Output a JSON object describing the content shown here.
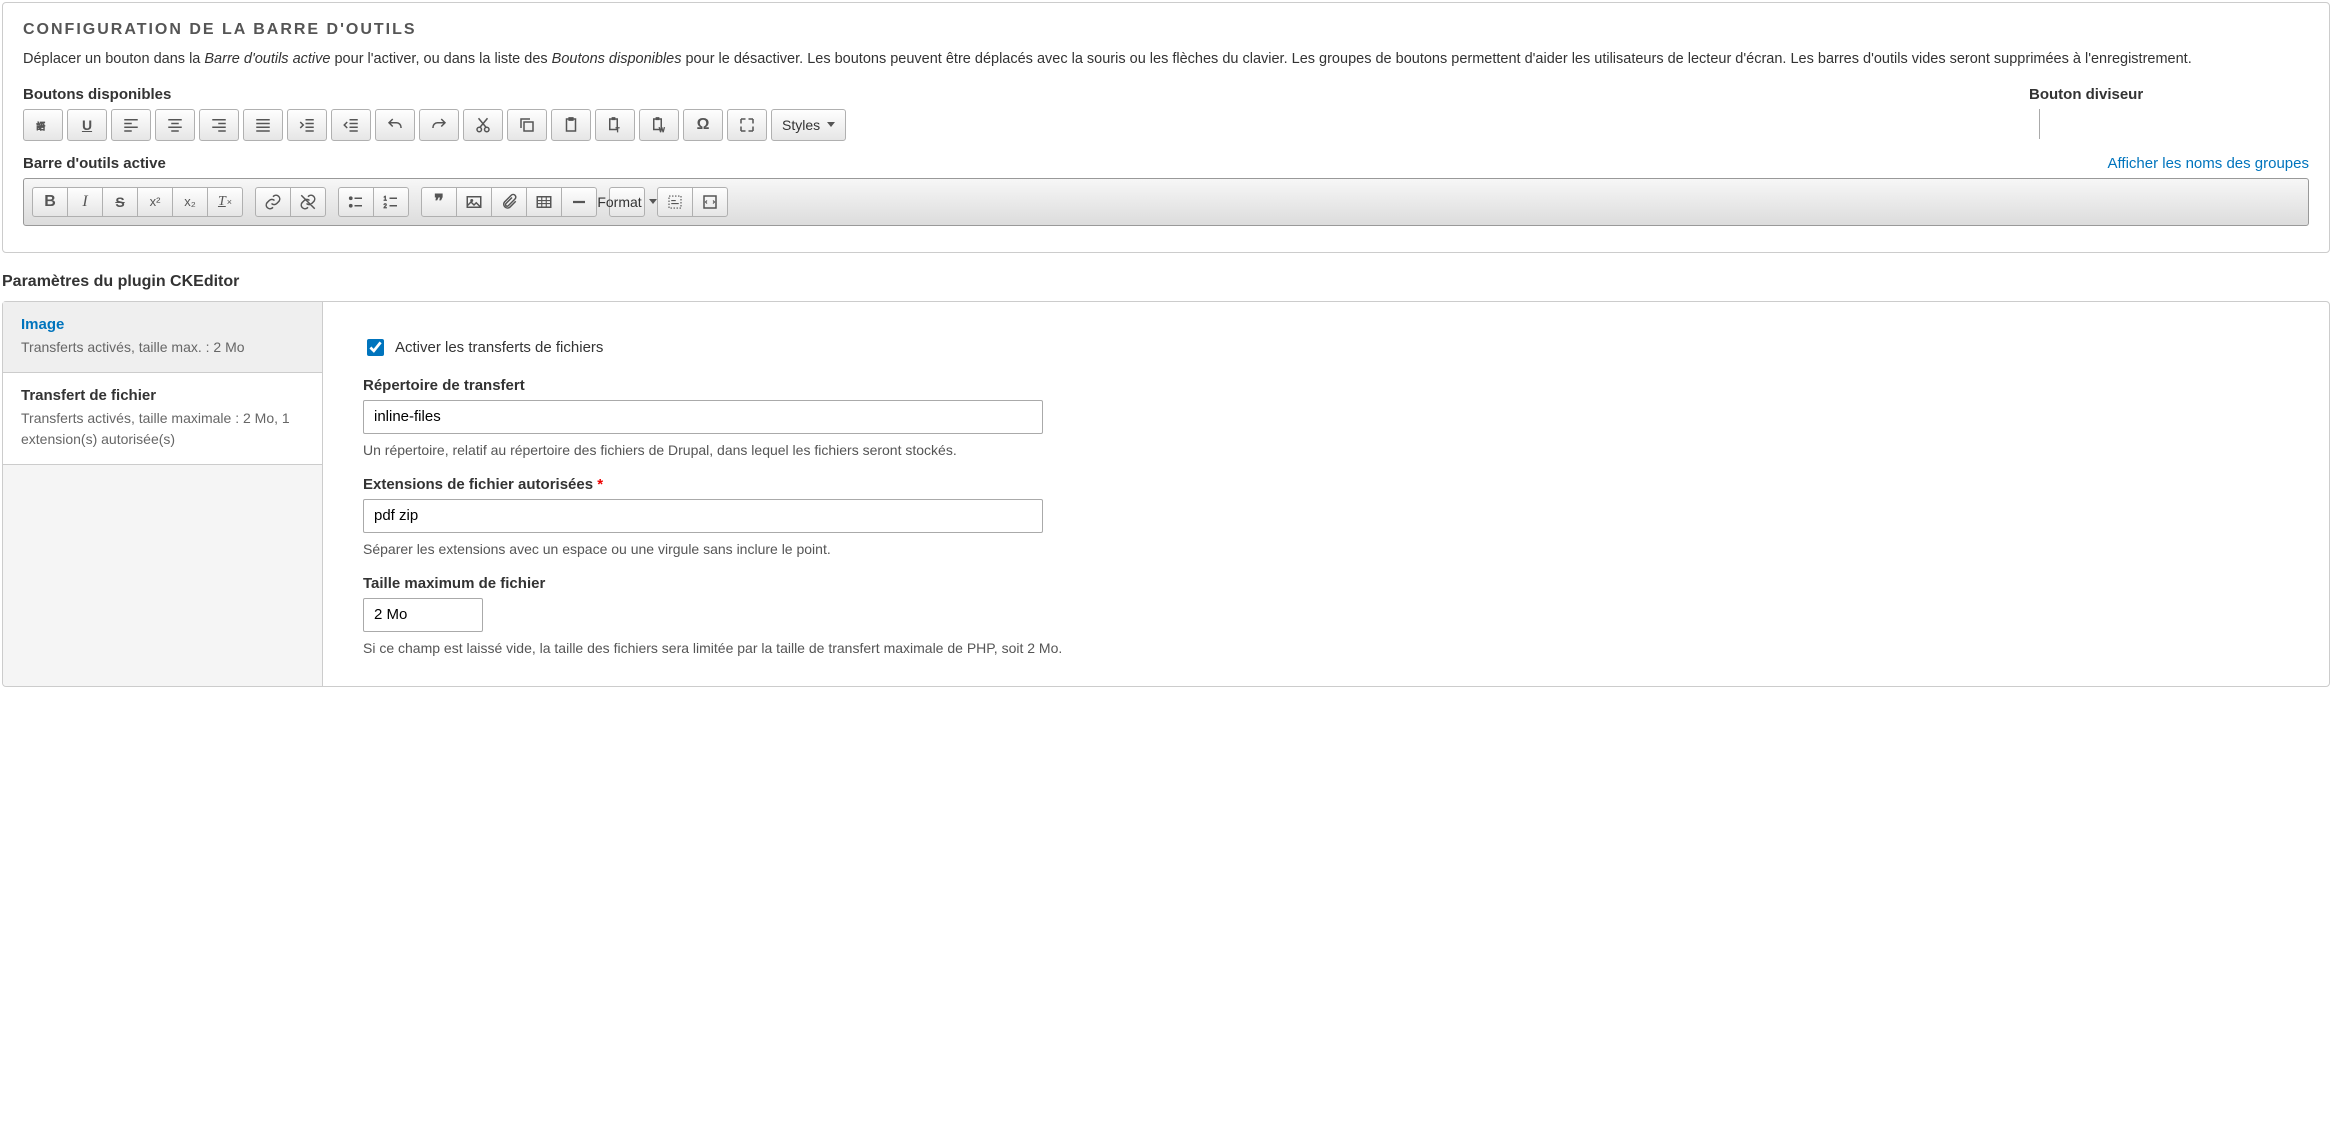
{
  "toolbar_config": {
    "title": "Configuration de la barre d'outils",
    "description_pre": "Déplacer un bouton dans la ",
    "description_em1": "Barre d'outils active",
    "description_mid": " pour l'activer, ou dans la liste des ",
    "description_em2": "Boutons disponibles",
    "description_post": " pour le désactiver. Les boutons peuvent être déplacés avec la souris ou les flèches du clavier. Les groupes de boutons permettent d'aider les utilisateurs de lecteur d'écran. Les barres d'outils vides seront supprimées à l'enregistrement.",
    "available_label": "Boutons disponibles",
    "divider_label": "Bouton diviseur",
    "active_label": "Barre d'outils active",
    "show_groups_link": "Afficher les noms des groupes",
    "styles_button": "Styles",
    "format_button": "Format"
  },
  "plugin_section": {
    "title": "Paramètres du plugin CKEditor",
    "tabs": {
      "image": {
        "title": "Image",
        "desc": "Transferts activés, taille max. : 2 Mo"
      },
      "file": {
        "title": "Transfert de fichier",
        "desc": "Transferts activés, taille maximale : 2 Mo, 1 extension(s) autorisée(s)"
      }
    },
    "form": {
      "enable_label": "Activer les transferts de fichiers",
      "enable_checked": true,
      "dir_label": "Répertoire de transfert",
      "dir_value": "inline-files",
      "dir_help": "Un répertoire, relatif au répertoire des fichiers de Drupal, dans lequel les fichiers seront stockés.",
      "ext_label": "Extensions de fichier autorisées",
      "ext_value": "pdf zip",
      "ext_help": "Séparer les extensions avec un espace ou une virgule sans inclure le point.",
      "size_label": "Taille maximum de fichier",
      "size_value": "2 Mo",
      "size_help": "Si ce champ est laissé vide, la taille des fichiers sera limitée par la taille de transfert maximale de PHP, soit 2 Mo."
    }
  }
}
